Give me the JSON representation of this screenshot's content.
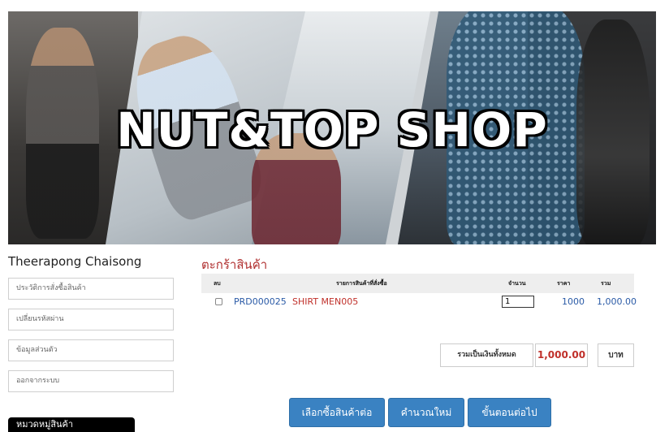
{
  "banner": {
    "brand": "NUT&TOP SHOP"
  },
  "sidebar": {
    "user_name": "Theerapong Chaisong",
    "links": [
      "ประวัติการสั่งซื้อสินค้า",
      "เปลี่ยนรหัสผ่าน",
      "ข้อมูลส่วนตัว",
      "ออกจากระบบ"
    ],
    "category_header": "หมวดหมู่สินค้า"
  },
  "cart": {
    "title": "ตะกร้าสินค้า",
    "headers": {
      "delete": "ลบ",
      "item": "รายการสินค้าที่สั่งซื้อ",
      "qty": "จำนวน",
      "price": "ราคา",
      "total": "รวม"
    },
    "items": [
      {
        "code": "PRD000025",
        "name": "SHIRT MEN005",
        "qty": "1",
        "price": "1000",
        "total": "1,000.00"
      }
    ],
    "summary": {
      "label": "รวมเป็นเงินทั้งหมด",
      "value": "1,000.00",
      "unit": "บาท"
    },
    "buttons": {
      "continue": "เลือกซื้อสินค้าต่อ",
      "recalc": "คำนวณใหม่",
      "next": "ขั้นตอนต่อไป"
    }
  },
  "colors": {
    "primary_button": "#3a82c2",
    "accent_red": "#c0302a",
    "link_blue": "#2a5aa6"
  }
}
